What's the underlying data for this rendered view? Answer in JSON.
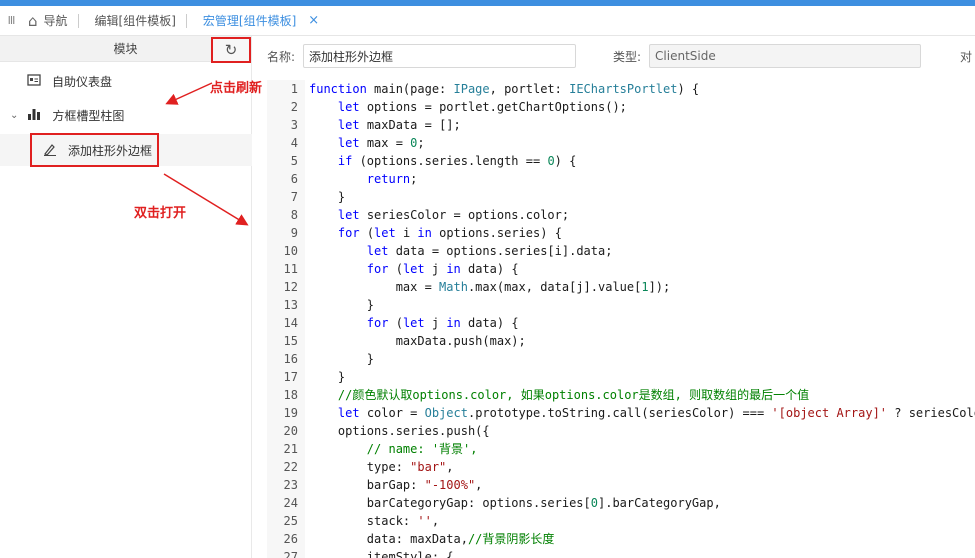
{
  "tabs": {
    "grip": "III",
    "items": [
      {
        "label": "导航",
        "icon": "home-icon"
      },
      {
        "label": "编辑[组件模板]"
      },
      {
        "label": "宏管理[组件模板]",
        "close": "×"
      }
    ]
  },
  "sidebar": {
    "header": "模块",
    "refresh_icon": "↻",
    "items": [
      {
        "label": "自助仪表盘",
        "icon": "dashboard-icon"
      },
      {
        "label": "方框槽型柱图",
        "icon": "bar-chart-icon"
      },
      {
        "label": "添加柱形外边框",
        "icon": "macro-edit-icon"
      }
    ]
  },
  "annotations": {
    "refresh": "点击刷新",
    "open": "双击打开"
  },
  "form": {
    "name_label": "名称:",
    "name_value": "添加柱形外边框",
    "type_label": "类型:",
    "type_value": "ClientSide",
    "other_label": "对"
  },
  "code": [
    "function main(page: IPage, portlet: IEChartsPortlet) {",
    "    let options = portlet.getChartOptions();",
    "    let maxData = [];",
    "    let max = 0;",
    "    if (options.series.length == 0) {",
    "        return;",
    "    }",
    "    let seriesColor = options.color;",
    "    for (let i in options.series) {",
    "        let data = options.series[i].data;",
    "        for (let j in data) {",
    "            max = Math.max(max, data[j].value[1]);",
    "        }",
    "        for (let j in data) {",
    "            maxData.push(max);",
    "        }",
    "    }",
    "    //颜色默认取options.color, 如果options.color是数组, 则取数组的最后一个值",
    "    let color = Object.prototype.toString.call(seriesColor) === '[object Array]' ? seriesColo",
    "    options.series.push({",
    "        // name: '背景',",
    "        type: \"bar\",",
    "        barGap: \"-100%\",",
    "        barCategoryGap: options.series[0].barCategoryGap,",
    "        stack: '',",
    "        data: maxData,//背景阴影长度",
    "        itemStyle: {"
  ]
}
